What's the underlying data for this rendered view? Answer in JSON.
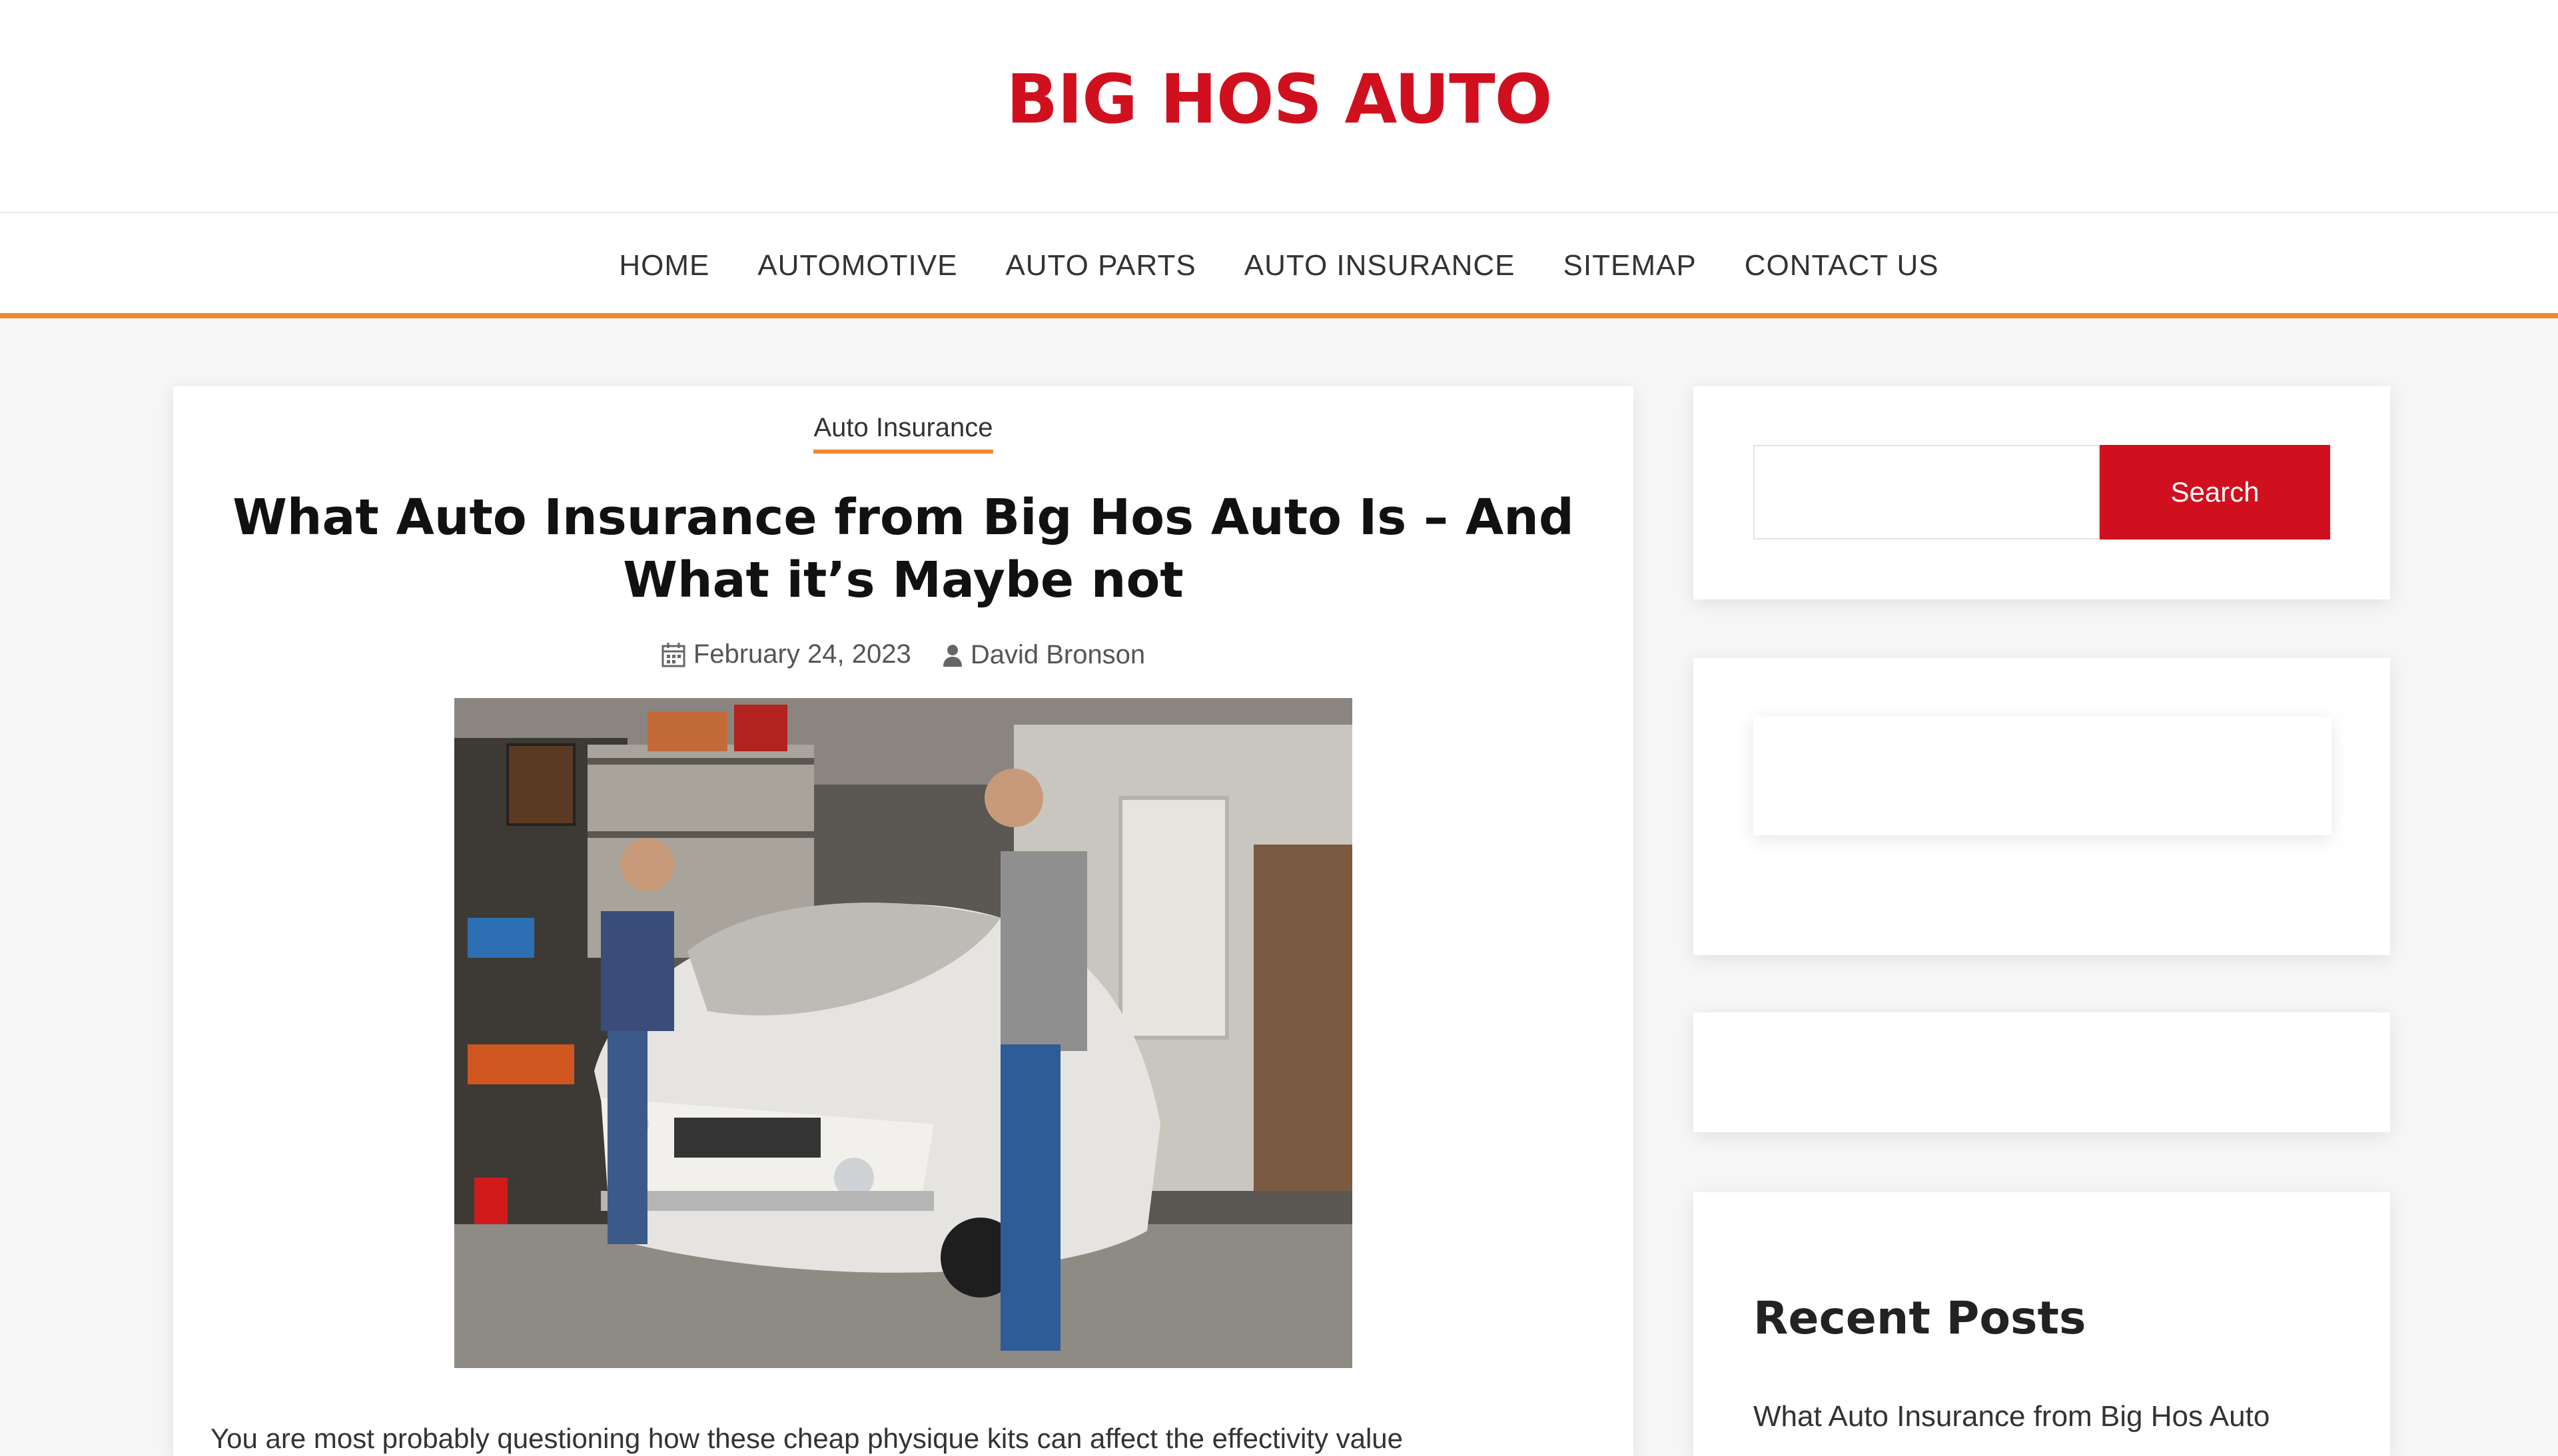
{
  "site": {
    "title": "BIG HOS AUTO",
    "brand_color": "#d0101e",
    "accent_color": "#ee8a2e"
  },
  "nav": {
    "items": [
      "HOME",
      "AUTOMOTIVE",
      "AUTO PARTS",
      "AUTO INSURANCE",
      "SITEMAP",
      "CONTACT US"
    ]
  },
  "post": {
    "category": "Auto Insurance",
    "title": "What Auto Insurance from Big Hos Auto Is – And What it’s Maybe not",
    "date": "February 24, 2023",
    "date_icon": "calendar-icon",
    "author": "David Bronson",
    "author_icon": "user-icon",
    "excerpt": "You are most probably questioning how these cheap physique kits can affect the effectivity value"
  },
  "sidebar": {
    "search": {
      "placeholder": "",
      "button_label": "Search"
    },
    "recent": {
      "heading": "Recent Posts",
      "items": [
        "What Auto Insurance from Big Hos Auto"
      ]
    }
  }
}
